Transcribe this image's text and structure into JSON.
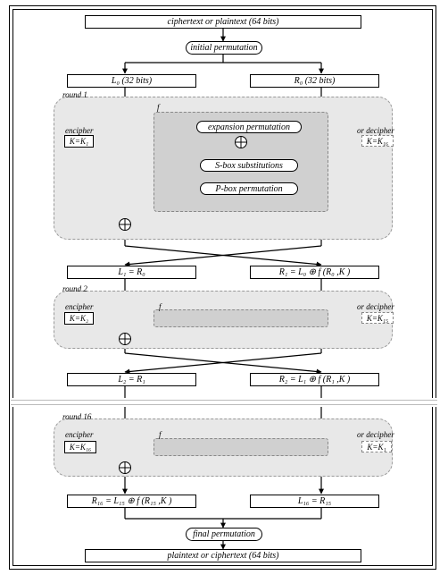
{
  "title": "DES Feistel cipher round structure",
  "top": {
    "input": "ciphertext or plaintext (64 bits)",
    "ip": "initial permutation"
  },
  "halves": {
    "L0": "L₀ (32 bits)",
    "R0": "R₀ (32 bits)"
  },
  "round1": {
    "label": "round 1",
    "encipher": "encipher",
    "K": "K=K₁",
    "orDecipher": "or decipher",
    "Kd": "K=K₁₆",
    "f": "f",
    "exp": "expansion  permutation",
    "sbox": "S-box  substitutions",
    "pbox": "P-box  permutation",
    "L1": "L₁ = R₀",
    "R1": "R₁ = L₀  ⊕   f (R₀ ,K )"
  },
  "round2": {
    "label": "round 2",
    "encipher": "encipher",
    "K": "K=K₂",
    "orDecipher": "or decipher",
    "Kd": "K=K₁₅",
    "f": "f",
    "L2": "L₂ = R₁",
    "R2": "R₂ = L₁  ⊕   f (R₁ ,K )"
  },
  "round16": {
    "label": "round 16",
    "encipher": "encipher",
    "K": "K=K₁₆",
    "orDecipher": "or decipher",
    "Kd": "K=K₁",
    "f": "f",
    "R16": "R₁₆ = L₁₅ ⊕  f (R₁₅ ,K )",
    "L16": "L₁₆ = R₁₅"
  },
  "bottom": {
    "fp": "final permutation",
    "output": "plaintext or ciphertext (64 bits)"
  }
}
